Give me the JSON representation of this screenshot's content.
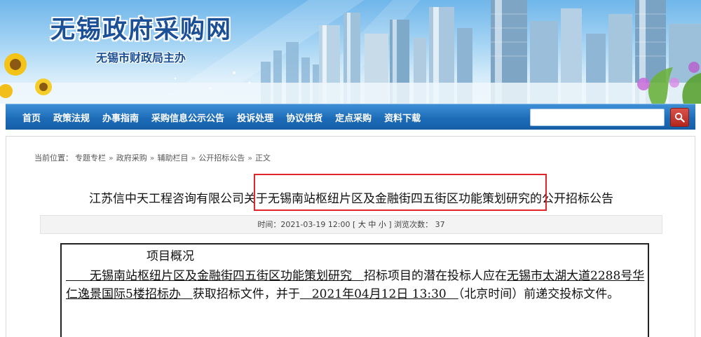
{
  "header": {
    "title": "无锡政府采购网",
    "subtitle": "无锡市财政局主办"
  },
  "nav": {
    "items": [
      "首页",
      "政策法规",
      "办事指南",
      "采购信息公示公告",
      "投诉处理",
      "协议供货",
      "定点采购",
      "资料下载"
    ],
    "search_placeholder": ""
  },
  "breadcrumb": {
    "prefix": "当前位置：",
    "items": [
      "专题专栏",
      "政府采购",
      "辅助栏目",
      "公开招标公告",
      "正文"
    ],
    "separator": "»"
  },
  "article": {
    "title": "江苏信中天工程咨询有限公司关于无锡南站枢纽片区及金融街四五街区功能策划研究的公开招标公告",
    "meta": {
      "time_label": "时间：",
      "time": "2021-03-19 12:00",
      "font_open": "[",
      "font_large": "大",
      "font_medium": "中",
      "font_small": "小",
      "font_close": "]",
      "views_label": "浏览次数：",
      "views": "37"
    }
  },
  "document": {
    "heading": "项目概况",
    "blank_a": "　　",
    "project_name": "无锡南站枢纽片区及金融街四五街区功能策划研究",
    "blank_b": "　",
    "text_1": "招标项目的潜在投标人应在",
    "location": "无锡市太湖大道2288号华仁逸景国际5楼招标办",
    "blank_c": "　",
    "text_2": "获取招标文件，并于",
    "deadline": "2021年04月12日 13:30",
    "blank_d": "　",
    "text_3": "（北京时间）前递交投标文件。"
  },
  "colors": {
    "nav_blue": "#1d6cb8",
    "title_blue": "#1b4f96",
    "highlight_red": "#e0262b",
    "search_red": "#c0392b"
  }
}
